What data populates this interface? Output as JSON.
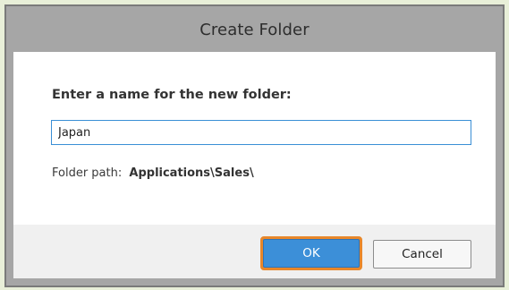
{
  "dialog": {
    "title": "Create Folder",
    "prompt": "Enter a name for the new folder:",
    "name_value": "Japan",
    "path_label": "Folder path:",
    "path_value": "Applications\\Sales\\"
  },
  "buttons": {
    "ok_label": "OK",
    "cancel_label": "Cancel"
  },
  "colors": {
    "primary_button": "#3c8fd8",
    "focus_ring": "#e8872a",
    "input_border": "#3a8fd6",
    "titlebar": "#a6a6a6"
  }
}
